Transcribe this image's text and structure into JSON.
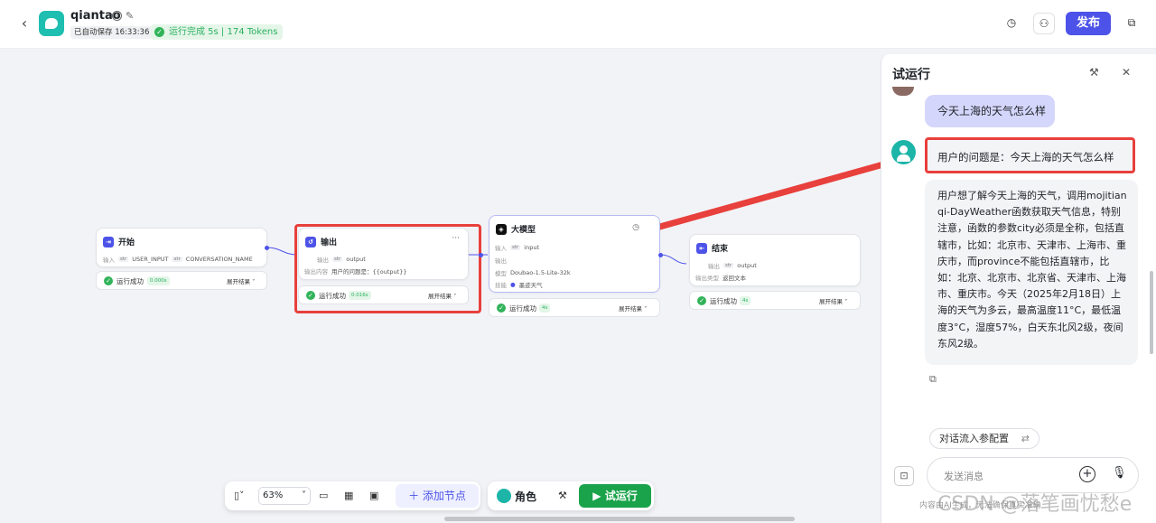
{
  "header": {
    "app_name": "qiantao",
    "autosave": "已自动保存 16:33:36",
    "run_status": "运行完成 5s | 174 Tokens",
    "publish_label": "发布"
  },
  "nodes": {
    "start": {
      "title": "开始",
      "input_label": "输入",
      "type_tag": "str",
      "var1": "USER_INPUT",
      "var2": "CONVERSATION_NAME",
      "run_text": "运行成功",
      "time": "0.000s",
      "expand": "展开结果"
    },
    "output": {
      "title": "输出",
      "output_label": "输出",
      "type_tag": "str",
      "var": "output",
      "content_label": "输出内容",
      "content": "用户的问题是：{{output}}",
      "run_text": "运行成功",
      "time": "0.016s",
      "expand": "展开结果"
    },
    "llm": {
      "title": "大模型",
      "input_label": "输入",
      "type_tag": "str",
      "input_var": "input",
      "output_label": "输出",
      "model_label": "模型",
      "model": "Doubao-1.5-Lite-32k",
      "skill_label": "技能",
      "skill": "墨迹天气",
      "run_text": "运行成功",
      "time": "4s",
      "expand": "展开结果"
    },
    "end": {
      "title": "结束",
      "output_label": "输出",
      "type_tag": "str",
      "var": "output",
      "return_label": "输出类型",
      "return_type": "返回文本",
      "run_text": "运行成功",
      "time": "4s",
      "expand": "展开结果"
    }
  },
  "toolbar": {
    "zoom": "63%",
    "add_node": "添加节点",
    "role": "角色",
    "trial_run": "试运行"
  },
  "panel": {
    "title": "试运行",
    "user_message": "今天上海的天气怎么样",
    "bot_reply_1": "用户的问题是：今天上海的天气怎么样",
    "bot_reply_2": "用户想了解今天上海的天气，调用mojitianqi-DayWeather函数获取天气信息，特别注意，函数的参数city必须是全称，包括直辖市，比如：北京市、天津市、上海市、重庆市，而province不能包括直辖市，比如：北京、北京市、北京省、天津市、上海市、重庆市。今天（2025年2月18日）上海的天气为多云，最高温度11°C，最低温度3°C，湿度57%，白天东北风2级，夜间东风2级。",
    "config_label": "对话流入参配置",
    "input_placeholder": "发送消息",
    "footer": "内容由AI生成，无法确保真实准确"
  },
  "watermark": "CSDN @落笔画忧愁e",
  "colors": {
    "accent": "#4d53e8",
    "success": "#32b35a",
    "highlight": "#e8403c",
    "run_button": "#1aa34a"
  }
}
